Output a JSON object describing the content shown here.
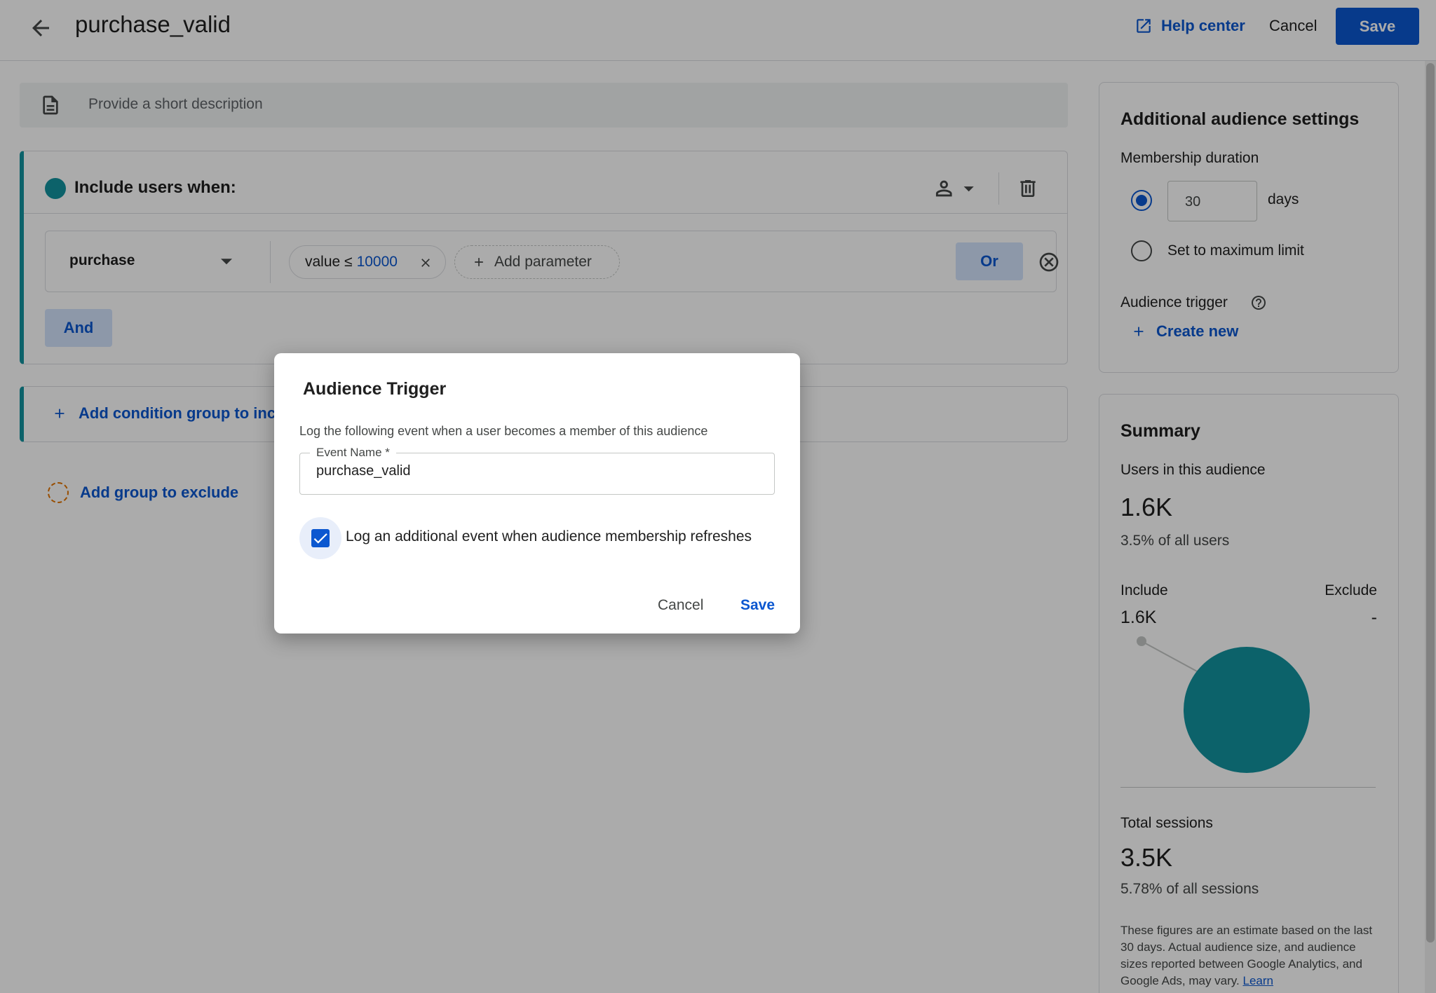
{
  "header": {
    "title": "purchase_valid",
    "help_label": "Help center",
    "cancel_label": "Cancel",
    "save_label": "Save"
  },
  "description": {
    "placeholder": "Provide a short description"
  },
  "include_group": {
    "title": "Include users when:",
    "condition": {
      "event_name": "purchase",
      "parameter_prefix": "value ≤",
      "parameter_value": "10000",
      "add_parameter_label": "Add parameter",
      "or_label": "Or"
    },
    "and_label": "And"
  },
  "add_condition_group_label": "Add condition group to include",
  "add_exclude_label": "Add group to exclude",
  "settings": {
    "title": "Additional audience settings",
    "membership_label": "Membership duration",
    "duration_value": "30",
    "duration_unit": "days",
    "max_limit_label": "Set to maximum limit",
    "trigger_label": "Audience trigger",
    "create_new_label": "Create new"
  },
  "summary": {
    "title": "Summary",
    "users_label": "Users in this audience",
    "users_value": "1.6K",
    "users_pct": "3.5% of all users",
    "include_label": "Include",
    "exclude_label": "Exclude",
    "include_value": "1.6K",
    "exclude_value": "-",
    "sessions_label": "Total sessions",
    "sessions_value": "3.5K",
    "sessions_pct": "5.78% of all sessions",
    "note": "These figures are an estimate based on the last 30 days. Actual audience size, and audience sizes reported between Google Analytics, and Google Ads, may vary.",
    "learn_label": "Learn",
    "accent_color": "#12939e"
  },
  "dialog": {
    "title": "Audience Trigger",
    "description": "Log the following event when a user becomes a member of this audience",
    "field_label": "Event Name *",
    "field_value": "purchase_valid",
    "checkbox_label": "Log an additional event when audience membership refreshes",
    "cancel_label": "Cancel",
    "save_label": "Save"
  }
}
